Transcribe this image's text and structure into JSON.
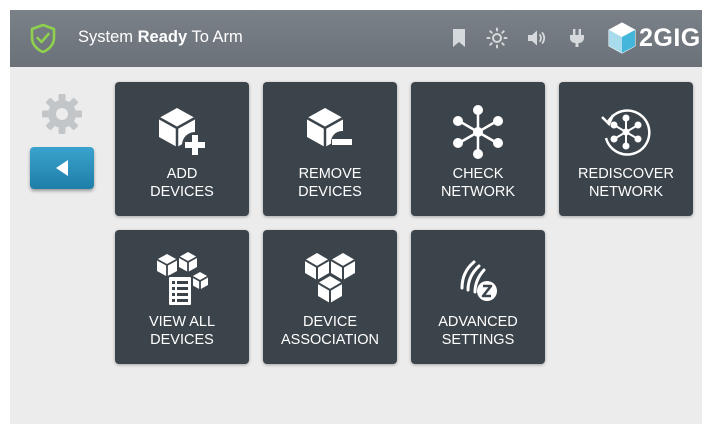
{
  "status_bar": {
    "status_prefix": "System",
    "status_bold": "Ready",
    "status_suffix": "To Arm",
    "icons": [
      "shield-check-icon",
      "bookmark-icon",
      "brightness-icon",
      "volume-icon",
      "power-plug-icon"
    ],
    "logo_text": "2GIG"
  },
  "sidebar": {
    "icons": [
      "gear-icon",
      "back-arrow-icon"
    ]
  },
  "tiles": [
    {
      "line1": "ADD",
      "line2": "DEVICES",
      "icon": "add-device-icon"
    },
    {
      "line1": "REMOVE",
      "line2": "DEVICES",
      "icon": "remove-device-icon"
    },
    {
      "line1": "CHECK",
      "line2": "NETWORK",
      "icon": "network-icon"
    },
    {
      "line1": "REDISCOVER",
      "line2": "NETWORK",
      "icon": "rediscover-network-icon"
    },
    {
      "line1": "VIEW ALL",
      "line2": "DEVICES",
      "icon": "view-devices-icon"
    },
    {
      "line1": "DEVICE",
      "line2": "ASSOCIATION",
      "icon": "association-icon"
    },
    {
      "line1": "ADVANCED",
      "line2": "SETTINGS",
      "icon": "zwave-icon"
    }
  ],
  "colors": {
    "header": "#6f767d",
    "tile": "#3c444b",
    "background": "#ececed",
    "accent_button": "#2b8fbb",
    "shield_green": "#8fd14f"
  }
}
